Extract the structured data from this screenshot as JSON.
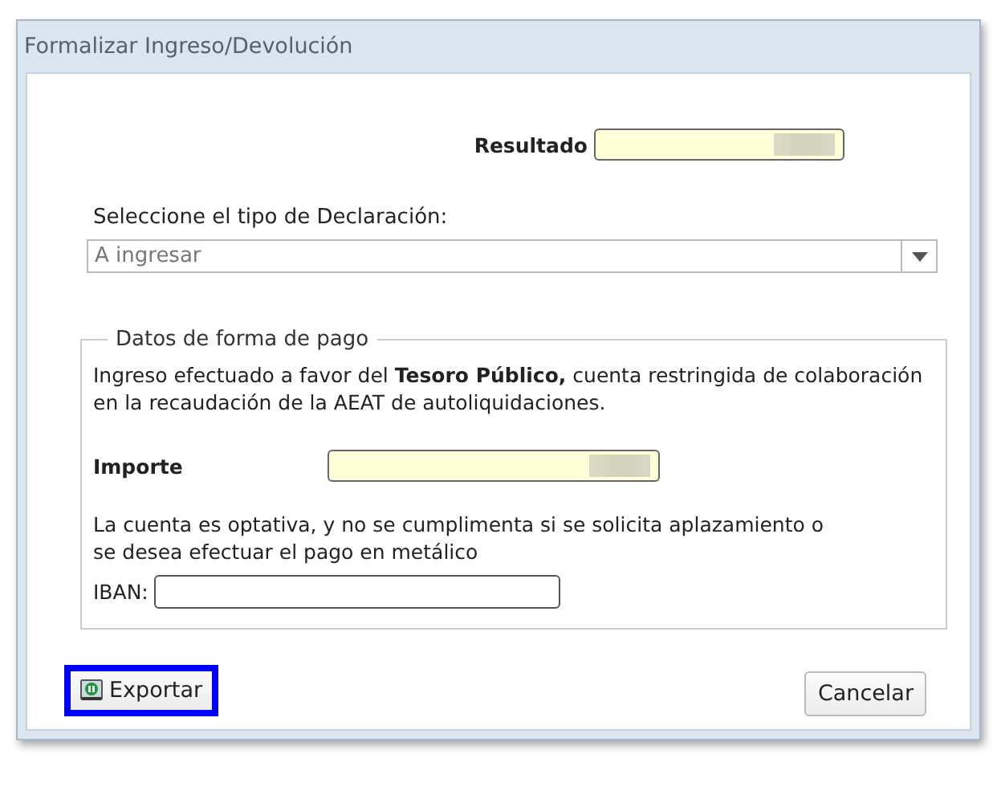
{
  "window": {
    "title": "Formalizar Ingreso/Devolución"
  },
  "resultado": {
    "label": "Resultado",
    "redacted": true
  },
  "declaracion": {
    "label": "Seleccione el tipo de Declaración:",
    "value": "A ingresar"
  },
  "pago": {
    "legend": "Datos de forma de pago",
    "intro": "Ingreso efectuado a favor del **Tesoro Público,** cuenta restringida de colaboración\nen la recaudación de la AEAT de autoliquidaciones.",
    "importe": {
      "label": "Importe",
      "redacted": true
    },
    "note": "La cuenta es optativa, y no se cumplimenta si se solicita aplazamiento o\nse desea efectuar el pago en metálico",
    "iban": {
      "label": "IBAN:"
    }
  },
  "buttons": [
    {
      "kind": "export",
      "label": "Exportar",
      "highlighted": true
    },
    {
      "kind": "plain",
      "label": "Cancelar",
      "highlighted": false
    }
  ]
}
